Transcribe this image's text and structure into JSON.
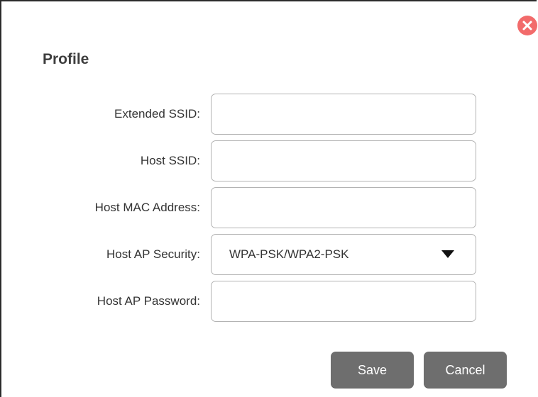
{
  "dialog": {
    "title": "Profile",
    "close_icon": "close-icon",
    "close_color": "#f26b6b"
  },
  "form": {
    "extended_ssid": {
      "label": "Extended SSID:",
      "value": ""
    },
    "host_ssid": {
      "label": "Host SSID:",
      "value": ""
    },
    "host_mac": {
      "label": "Host MAC Address:",
      "value": ""
    },
    "host_ap_security": {
      "label": "Host AP Security:",
      "selected": "WPA-PSK/WPA2-PSK",
      "arrow_icon": "triangle-down-icon"
    },
    "host_ap_password": {
      "label": "Host AP Password:",
      "value": ""
    }
  },
  "buttons": {
    "save_label": "Save",
    "cancel_label": "Cancel",
    "button_color": "#6e6e6e"
  }
}
